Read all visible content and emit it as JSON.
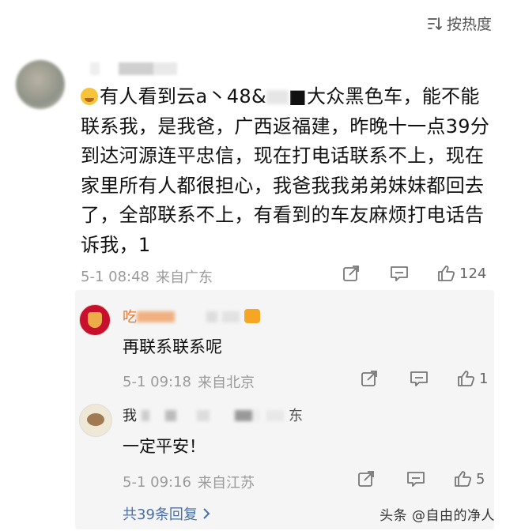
{
  "sort": {
    "label": "按热度",
    "icon": "sort-lines-icon"
  },
  "comment": {
    "emoji": "crying-face-emoji",
    "text_part1": "有人看到云a丶48&",
    "text_part2": "■大众黑色车，能不能联系我，是我爸，广西返福建，昨晚十一点39分到达河源连平忠信，现在打电话联系不上，现在家里所有人都很担心，我爸我我弟弟妹妹都回去了，全部联系不上，有看到的车友麻烦打电话告诉我，1",
    "time": "5-1 08:48",
    "location": "来自广东",
    "like_count": "124"
  },
  "replies": [
    {
      "name_start": "吃",
      "text": "再联系联系呢",
      "time": "5-1 09:18",
      "location": "来自北京",
      "like_count": "1"
    },
    {
      "name_start": "我",
      "name_end": "东",
      "text": "一定平安！",
      "time": "5-1 09:16",
      "location": "来自江苏",
      "like_count": "5"
    }
  ],
  "more_replies": {
    "label": "共39条回复"
  },
  "watermark": "头条 @自由的净人"
}
